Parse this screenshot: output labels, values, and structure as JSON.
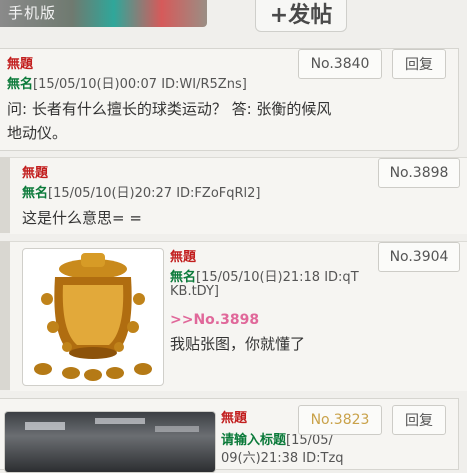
{
  "top": {
    "banner_label": "手机版",
    "post_button": "+发帖"
  },
  "posts": [
    {
      "subject": "無題",
      "name": "無名",
      "meta": "[15/05/10(日)00:07 ID:WI/R5Zns]",
      "no": "No.3840",
      "reply": "回复",
      "body_line1": "问: 长者有什么擅长的球类运动？ 答: 张衡的候风",
      "body_line2": "地动仪。"
    },
    {
      "subject": "無題",
      "name": "無名",
      "meta": "[15/05/10(日)20:27 ID:FZoFqRl2]",
      "no": "No.3898",
      "body": "这是什么意思= ="
    },
    {
      "subject": "無題",
      "name": "無名",
      "meta_line1": "[15/05/10(日)21:18 ID:qT",
      "meta_line2": "KB.tDY]",
      "no": "No.3904",
      "quote": ">>No.3898",
      "body": "我贴张图，你就懂了",
      "image": "seismograph-image"
    },
    {
      "subject": "無題",
      "name": "请输入标题",
      "meta_line1": "[15/05/",
      "meta_line2": "09(六)21:38 ID:Tzq",
      "no": "No.3823",
      "reply": "回复",
      "image": "photo-image"
    }
  ],
  "colors": {
    "subject": "#c21e1e",
    "name": "#0b7a3a",
    "quote": "#e0689a",
    "background": "#f0efec"
  }
}
